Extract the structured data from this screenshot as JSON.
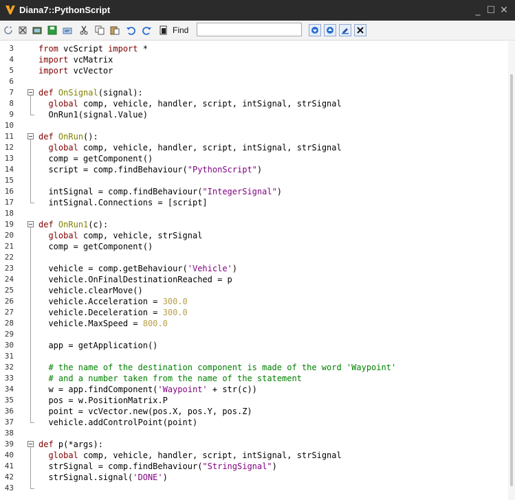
{
  "window": {
    "title": "Diana7::PythonScript",
    "minimize_glyph": "_",
    "maximize_glyph": "☐",
    "close_glyph": "✕",
    "logo_letter": "V",
    "logo_color": "#f5a623"
  },
  "toolbar": {
    "icons": [
      "refresh-icon",
      "cut-script-icon",
      "image-icon",
      "save-icon",
      "compile-icon",
      "cut-icon",
      "copy-icon",
      "paste-icon",
      "undo-icon",
      "redo-icon",
      "page-icon"
    ],
    "find_label": "Find",
    "find_value": "",
    "nav_icons": [
      "find-down-icon",
      "find-up-icon",
      "highlight-icon",
      "clear-icon"
    ]
  },
  "colors": {
    "keyword": "#800000",
    "function": "#808000",
    "string": "#7f007f",
    "number": "#b7a04b",
    "comment": "#008000"
  },
  "editor": {
    "lines": [
      {
        "n": "3",
        "t": [
          [
            "kw",
            "from"
          ],
          [
            "p",
            " vcScript "
          ],
          [
            "kw",
            "import"
          ],
          [
            "p",
            " *"
          ]
        ]
      },
      {
        "n": "4",
        "t": [
          [
            "kw",
            "import"
          ],
          [
            "p",
            " vcMatrix"
          ]
        ]
      },
      {
        "n": "5",
        "t": [
          [
            "kw",
            "import"
          ],
          [
            "p",
            " vcVector"
          ]
        ]
      },
      {
        "n": "6",
        "t": []
      },
      {
        "n": "7",
        "t": [
          [
            "kw",
            "def"
          ],
          [
            "p",
            " "
          ],
          [
            "fn",
            "OnSignal"
          ],
          [
            "p",
            "(signal):"
          ]
        ]
      },
      {
        "n": "8",
        "t": [
          [
            "p",
            "  "
          ],
          [
            "kw",
            "global"
          ],
          [
            "p",
            " comp, vehicle, handler, script, intSignal, strSignal"
          ]
        ]
      },
      {
        "n": "9",
        "t": [
          [
            "p",
            "  OnRun1(signal.Value)"
          ]
        ]
      },
      {
        "n": "10",
        "t": []
      },
      {
        "n": "11",
        "t": [
          [
            "kw",
            "def"
          ],
          [
            "p",
            " "
          ],
          [
            "fn",
            "OnRun"
          ],
          [
            "p",
            "():"
          ]
        ]
      },
      {
        "n": "12",
        "t": [
          [
            "p",
            "  "
          ],
          [
            "kw",
            "global"
          ],
          [
            "p",
            " comp, vehicle, handler, script, intSignal, strSignal"
          ]
        ]
      },
      {
        "n": "13",
        "t": [
          [
            "p",
            "  comp = getComponent()"
          ]
        ]
      },
      {
        "n": "14",
        "t": [
          [
            "p",
            "  script = comp.findBehaviour("
          ],
          [
            "str",
            "\"PythonScript\""
          ],
          [
            "p",
            ")"
          ]
        ]
      },
      {
        "n": "15",
        "t": []
      },
      {
        "n": "16",
        "t": [
          [
            "p",
            "  intSignal = comp.findBehaviour("
          ],
          [
            "str",
            "\"IntegerSignal\""
          ],
          [
            "p",
            ")"
          ]
        ]
      },
      {
        "n": "17",
        "t": [
          [
            "p",
            "  intSignal.Connections = [script]"
          ]
        ]
      },
      {
        "n": "18",
        "t": []
      },
      {
        "n": "19",
        "t": [
          [
            "kw",
            "def"
          ],
          [
            "p",
            " "
          ],
          [
            "fn",
            "OnRun1"
          ],
          [
            "p",
            "(c):"
          ]
        ]
      },
      {
        "n": "20",
        "t": [
          [
            "p",
            "  "
          ],
          [
            "kw",
            "global"
          ],
          [
            "p",
            " comp, vehicle, strSignal"
          ]
        ]
      },
      {
        "n": "21",
        "t": [
          [
            "p",
            "  comp = getComponent()"
          ]
        ]
      },
      {
        "n": "22",
        "t": []
      },
      {
        "n": "23",
        "t": [
          [
            "p",
            "  vehicle = comp.getBehaviour("
          ],
          [
            "str",
            "'Vehicle'"
          ],
          [
            "p",
            ")"
          ]
        ]
      },
      {
        "n": "24",
        "t": [
          [
            "p",
            "  vehicle.OnFinalDestinationReached = p"
          ]
        ]
      },
      {
        "n": "25",
        "t": [
          [
            "p",
            "  vehicle.clearMove()"
          ]
        ]
      },
      {
        "n": "26",
        "t": [
          [
            "p",
            "  vehicle.Acceleration = "
          ],
          [
            "num",
            "300.0"
          ]
        ]
      },
      {
        "n": "27",
        "t": [
          [
            "p",
            "  vehicle.Deceleration = "
          ],
          [
            "num",
            "300.0"
          ]
        ]
      },
      {
        "n": "28",
        "t": [
          [
            "p",
            "  vehicle.MaxSpeed = "
          ],
          [
            "num",
            "800.0"
          ]
        ]
      },
      {
        "n": "29",
        "t": []
      },
      {
        "n": "30",
        "t": [
          [
            "p",
            "  app = getApplication()"
          ]
        ]
      },
      {
        "n": "31",
        "t": []
      },
      {
        "n": "32",
        "t": [
          [
            "p",
            "  "
          ],
          [
            "cmt",
            "# the name of the destination component is made of the word 'Waypoint'"
          ]
        ]
      },
      {
        "n": "33",
        "t": [
          [
            "p",
            "  "
          ],
          [
            "cmt",
            "# and a number taken from the name of the statement"
          ]
        ]
      },
      {
        "n": "34",
        "t": [
          [
            "p",
            "  w = app.findComponent("
          ],
          [
            "str",
            "'Waypoint'"
          ],
          [
            "p",
            " + str(c))"
          ]
        ]
      },
      {
        "n": "35",
        "t": [
          [
            "p",
            "  pos = w.PositionMatrix.P"
          ]
        ]
      },
      {
        "n": "36",
        "t": [
          [
            "p",
            "  point = vcVector.new(pos.X, pos.Y, pos.Z)"
          ]
        ]
      },
      {
        "n": "37",
        "t": [
          [
            "p",
            "  vehicle.addControlPoint(point)"
          ]
        ]
      },
      {
        "n": "38",
        "t": []
      },
      {
        "n": "39",
        "t": [
          [
            "kw",
            "def"
          ],
          [
            "p",
            " p(*args):"
          ]
        ]
      },
      {
        "n": "40",
        "t": [
          [
            "p",
            "  "
          ],
          [
            "kw",
            "global"
          ],
          [
            "p",
            " comp, vehicle, handler, script, intSignal, strSignal"
          ]
        ]
      },
      {
        "n": "41",
        "t": [
          [
            "p",
            "  strSignal = comp.findBehaviour("
          ],
          [
            "str",
            "\"StringSignal\""
          ],
          [
            "p",
            ")"
          ]
        ]
      },
      {
        "n": "42",
        "t": [
          [
            "p",
            "  strSignal.signal("
          ],
          [
            "str",
            "'DONE'"
          ],
          [
            "p",
            ")"
          ]
        ]
      },
      {
        "n": "43",
        "t": []
      }
    ]
  }
}
